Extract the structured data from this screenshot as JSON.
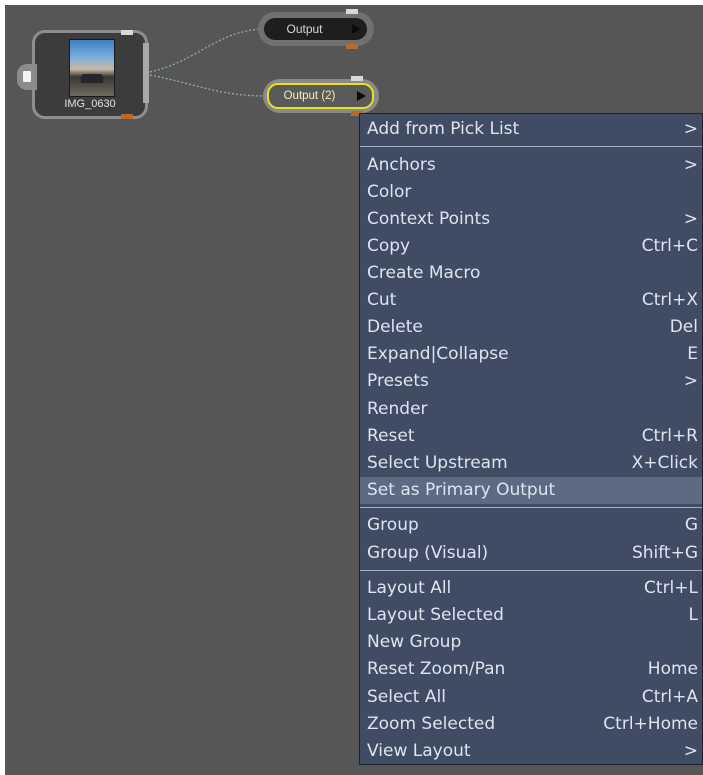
{
  "nodes": {
    "image_node": {
      "label": "IMG_0630"
    },
    "output_1": {
      "label": "Output"
    },
    "output_2": {
      "label": "Output (2)"
    }
  },
  "context_menu": {
    "groups": [
      [
        {
          "label": "Add from Pick List",
          "shortcut": ">"
        }
      ],
      [
        {
          "label": "Anchors",
          "shortcut": ">"
        },
        {
          "label": "Color",
          "shortcut": ""
        },
        {
          "label": "Context Points",
          "shortcut": ">"
        },
        {
          "label": "Copy",
          "shortcut": "Ctrl+C"
        },
        {
          "label": "Create Macro",
          "shortcut": ""
        },
        {
          "label": "Cut",
          "shortcut": "Ctrl+X"
        },
        {
          "label": "Delete",
          "shortcut": "Del"
        },
        {
          "label": "Expand|Collapse",
          "shortcut": "E"
        },
        {
          "label": "Presets",
          "shortcut": ">"
        },
        {
          "label": "Render",
          "shortcut": ""
        },
        {
          "label": "Reset",
          "shortcut": "Ctrl+R"
        },
        {
          "label": "Select Upstream",
          "shortcut": "X+Click"
        },
        {
          "label": "Set as Primary Output",
          "shortcut": "",
          "highlighted": true
        }
      ],
      [
        {
          "label": "Group",
          "shortcut": "G"
        },
        {
          "label": "Group (Visual)",
          "shortcut": "Shift+G"
        }
      ],
      [
        {
          "label": "Layout All",
          "shortcut": "Ctrl+L"
        },
        {
          "label": "Layout Selected",
          "shortcut": "L"
        },
        {
          "label": "New Group",
          "shortcut": ""
        },
        {
          "label": "Reset Zoom/Pan",
          "shortcut": "Home"
        },
        {
          "label": "Select All",
          "shortcut": "Ctrl+A"
        },
        {
          "label": "Zoom Selected",
          "shortcut": "Ctrl+Home"
        },
        {
          "label": "View Layout",
          "shortcut": ">"
        }
      ]
    ]
  },
  "colors": {
    "canvas": "#565656",
    "menu_bg": "#3f4c63",
    "menu_highlight": "#5c6a82",
    "selection_outline": "#e9e21a",
    "port_orange": "#b86a2a"
  }
}
